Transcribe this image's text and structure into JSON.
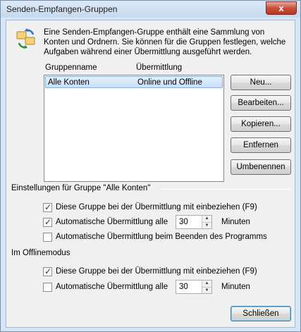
{
  "window": {
    "title": "Senden-Empfangen-Gruppen",
    "close_glyph": "x"
  },
  "intro": {
    "text": "Eine Senden-Empfangen-Gruppe enthält eine Sammlung von Konten und Ordnern. Sie können für die Gruppen festlegen, welche Aufgaben während einer Übermittlung ausgeführt werden."
  },
  "list": {
    "col_name": "Gruppenname",
    "col_transfer": "Übermittlung",
    "rows": [
      {
        "name": "Alle Konten",
        "transfer": "Online und Offline"
      }
    ]
  },
  "buttons": {
    "new": "Neu...",
    "edit": "Bearbeiten...",
    "copy": "Kopieren...",
    "remove": "Entfernen",
    "rename": "Umbenennen",
    "close": "Schließen"
  },
  "settings": {
    "header": "Einstellungen für Gruppe \"Alle Konten\"",
    "online": {
      "include_label": "Diese Gruppe bei der Übermittlung mit einbeziehen (F9)",
      "include_checked": true,
      "auto_label": "Automatische Übermittlung alle",
      "auto_checked": true,
      "auto_value": "30",
      "auto_unit": "Minuten",
      "on_exit_label": "Automatische Übermittlung beim Beenden des Programms",
      "on_exit_checked": false
    },
    "offline": {
      "header": "Im Offlinemodus",
      "include_label": "Diese Gruppe bei der Übermittlung mit einbeziehen (F9)",
      "include_checked": true,
      "auto_label": "Automatische Übermittlung alle",
      "auto_checked": false,
      "auto_value": "30",
      "auto_unit": "Minuten"
    }
  },
  "icons": {
    "intro": "send-receive-groups-icon"
  }
}
